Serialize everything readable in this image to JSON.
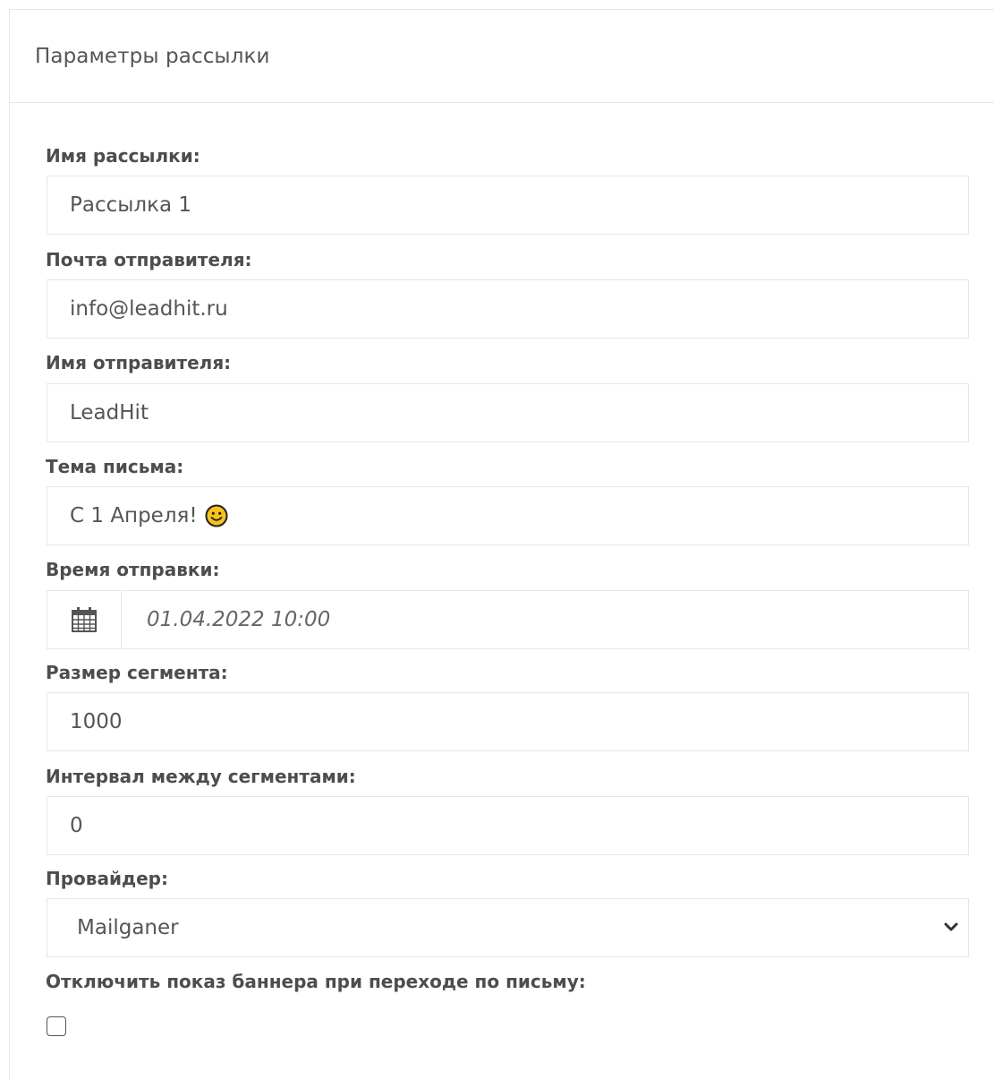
{
  "panel": {
    "title": "Параметры рассылки"
  },
  "fields": {
    "mailing_name": {
      "label": "Имя рассылки:",
      "value": "Рассылка 1"
    },
    "sender_email": {
      "label": "Почта отправителя:",
      "value": "info@leadhit.ru"
    },
    "sender_name": {
      "label": "Имя отправителя:",
      "value": "LeadHit"
    },
    "subject": {
      "label": "Тема письма:",
      "value": "С 1 Апреля!",
      "emoji_icon": "smile-emoji-icon"
    },
    "send_time": {
      "label": "Время отправки:",
      "value": "01.04.2022 10:00",
      "icon": "calendar-icon"
    },
    "segment_size": {
      "label": "Размер сегмента:",
      "value": "1000"
    },
    "segment_interval": {
      "label": "Интервал между сегментами:",
      "value": "0"
    },
    "provider": {
      "label": "Провайдер:",
      "selected": "Mailganer",
      "icon": "chevron-down-icon"
    },
    "disable_banner": {
      "label": "Отключить показ баннера при переходе по письму:",
      "checked": false
    }
  }
}
